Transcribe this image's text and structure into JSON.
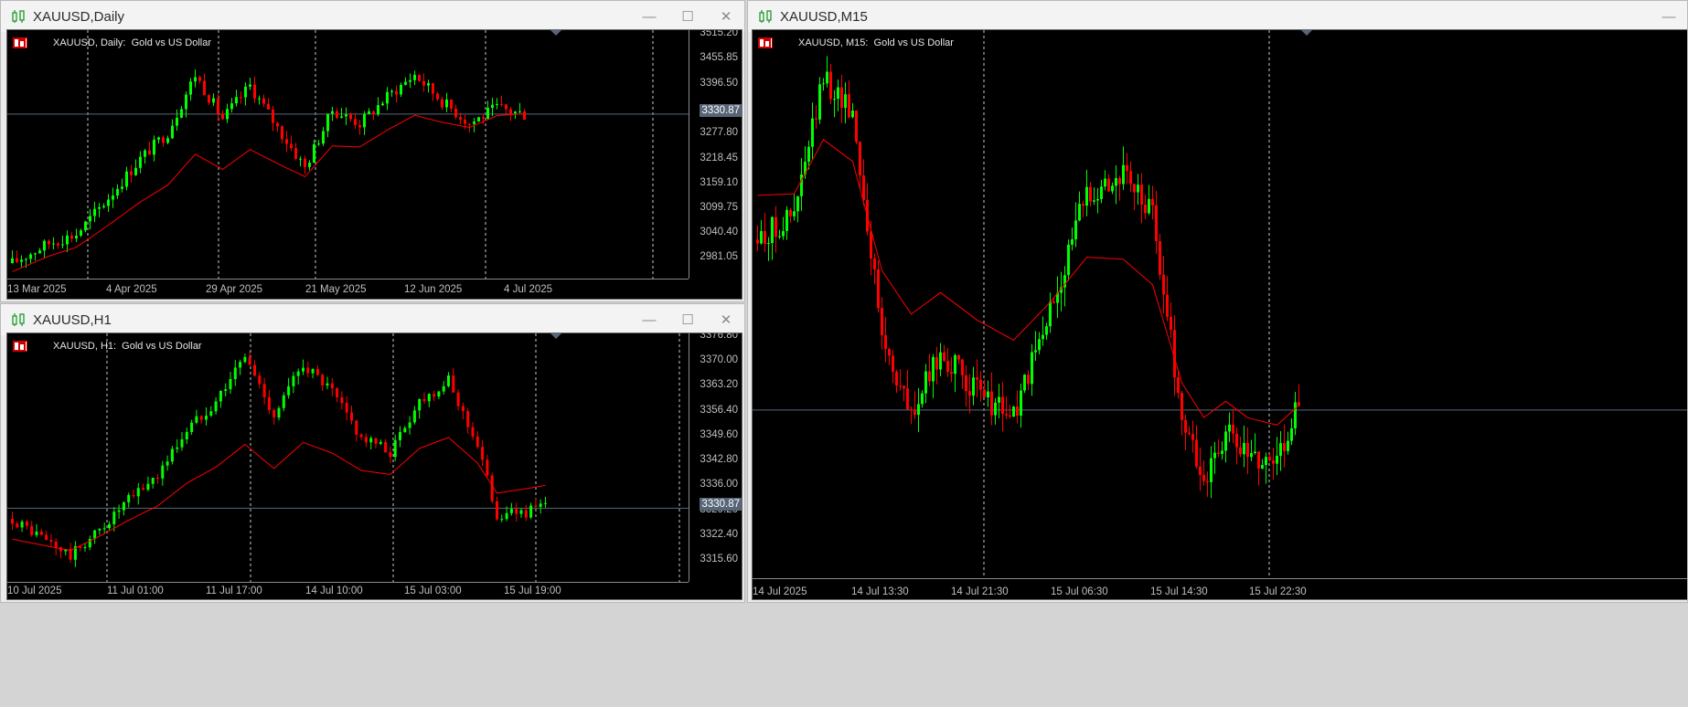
{
  "colors": {
    "bull": "#00ff00",
    "bear": "#ff0000",
    "ma": "#ff0000",
    "grid": "#c8c8c8",
    "price_line": "#56687a"
  },
  "windows": [
    {
      "id": "daily",
      "title": "XAUUSD,Daily",
      "chart_label": "XAUUSD, Daily:  Gold vs US Dollar",
      "current_price": "3330.87",
      "price_ticks": [
        "3515.20",
        "3455.85",
        "3396.50",
        "3337.15",
        "3277.80",
        "3218.45",
        "3159.10",
        "3099.75",
        "3040.40",
        "2981.05"
      ],
      "time_labels": [
        "13 Mar 2025",
        "4 Apr 2025",
        "29 Apr 2025",
        "21 May 2025",
        "12 Jun 2025",
        "4 Jul 2025"
      ],
      "controls": {
        "minimize": "—",
        "maximize": "☐",
        "close": "✕"
      }
    },
    {
      "id": "h1",
      "title": "XAUUSD,H1",
      "chart_label": "XAUUSD, H1:  Gold vs US Dollar",
      "current_price": "3330.87",
      "price_ticks": [
        "3376.80",
        "3370.00",
        "3363.20",
        "3356.40",
        "3349.60",
        "3342.80",
        "3336.00",
        "3329.20",
        "3322.40",
        "3315.60"
      ],
      "time_labels": [
        "10 Jul 2025",
        "11 Jul 01:00",
        "11 Jul 17:00",
        "14 Jul 10:00",
        "15 Jul 03:00",
        "15 Jul 19:00"
      ],
      "controls": {
        "minimize": "—",
        "maximize": "☐",
        "close": "✕"
      }
    },
    {
      "id": "m15",
      "title": "XAUUSD,M15",
      "chart_label": "XAUUSD, M15:  Gold vs US Dollar",
      "current_price": "3330.87",
      "price_ticks": [],
      "time_labels": [
        "14 Jul 2025",
        "14 Jul 13:30",
        "14 Jul 21:30",
        "15 Jul 06:30",
        "15 Jul 14:30",
        "15 Jul 22:30"
      ],
      "controls": {
        "minimize": "—",
        "maximize": "☐",
        "close": "✕"
      }
    }
  ],
  "chart_data": [
    {
      "type": "candlestick",
      "title": "XAUUSD, Daily:  Gold vs US Dollar",
      "symbol": "XAUUSD",
      "timeframe": "Daily",
      "ylim": [
        2960,
        3520
      ],
      "moving_average_start": 2960,
      "moving_average_end": 3333,
      "anchors": [
        [
          0,
          2995
        ],
        [
          8,
          3040
        ],
        [
          14,
          3060
        ],
        [
          20,
          3130
        ],
        [
          28,
          3230
        ],
        [
          34,
          3290
        ],
        [
          40,
          3420
        ],
        [
          46,
          3320
        ],
        [
          52,
          3395
        ],
        [
          58,
          3300
        ],
        [
          64,
          3210
        ],
        [
          70,
          3340
        ],
        [
          76,
          3310
        ],
        [
          82,
          3370
        ],
        [
          88,
          3420
        ],
        [
          94,
          3360
        ],
        [
          100,
          3310
        ],
        [
          106,
          3345
        ],
        [
          112,
          3330
        ]
      ],
      "current_price": 3330.87
    },
    {
      "type": "candlestick",
      "title": "XAUUSD, H1:  Gold vs US Dollar",
      "symbol": "XAUUSD",
      "timeframe": "H1",
      "ylim": [
        3311,
        3378
      ],
      "moving_average_start": 3318,
      "moving_average_end": 3342,
      "anchors": [
        [
          0,
          3328
        ],
        [
          6,
          3323
        ],
        [
          12,
          3318
        ],
        [
          18,
          3325
        ],
        [
          24,
          3333
        ],
        [
          30,
          3340
        ],
        [
          36,
          3352
        ],
        [
          42,
          3360
        ],
        [
          48,
          3372
        ],
        [
          54,
          3356
        ],
        [
          60,
          3370
        ],
        [
          66,
          3362
        ],
        [
          72,
          3350
        ],
        [
          78,
          3346
        ],
        [
          84,
          3360
        ],
        [
          90,
          3365
        ],
        [
          96,
          3348
        ],
        [
          100,
          3329
        ],
        [
          106,
          3330
        ],
        [
          110,
          3331
        ]
      ],
      "current_price": 3330.87
    },
    {
      "type": "candlestick",
      "title": "XAUUSD, M15:  Gold vs US Dollar",
      "symbol": "XAUUSD",
      "timeframe": "M15",
      "ylim": [
        3310,
        3378
      ],
      "moving_average_start": 3362,
      "moving_average_end": 3331,
      "anchors": [
        [
          0,
          3352
        ],
        [
          10,
          3355
        ],
        [
          18,
          3372
        ],
        [
          26,
          3368
        ],
        [
          34,
          3340
        ],
        [
          42,
          3330
        ],
        [
          50,
          3338
        ],
        [
          60,
          3333
        ],
        [
          70,
          3330
        ],
        [
          80,
          3343
        ],
        [
          90,
          3358
        ],
        [
          100,
          3360
        ],
        [
          108,
          3355
        ],
        [
          116,
          3330
        ],
        [
          122,
          3322
        ],
        [
          128,
          3328
        ],
        [
          134,
          3325
        ],
        [
          142,
          3325
        ],
        [
          148,
          3332
        ]
      ],
      "current_price": 3330.87
    }
  ]
}
